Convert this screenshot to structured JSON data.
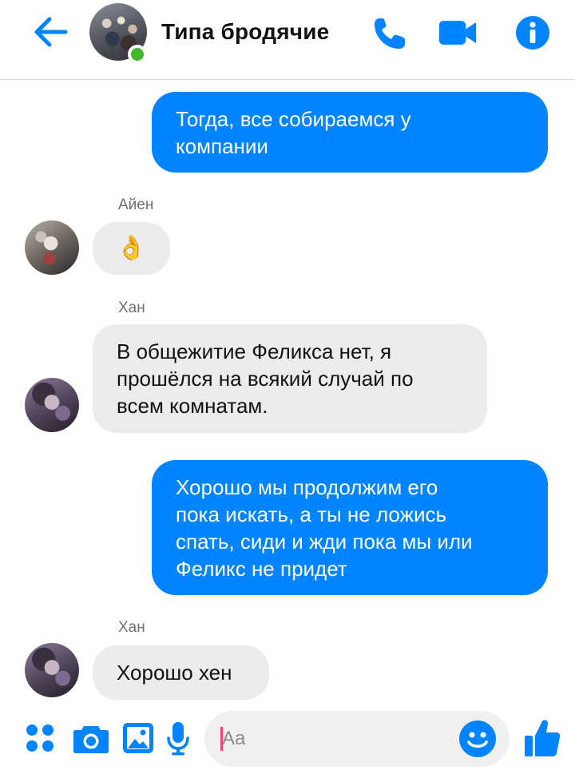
{
  "header": {
    "title": "Типа бродячие",
    "back_icon": "arrow-left-icon",
    "call_icon": "phone-icon",
    "video_icon": "video-camera-icon",
    "info_icon": "info-icon"
  },
  "messages": [
    {
      "direction": "outgoing",
      "lines": [
        "Тогда, все собираемся у",
        "компании"
      ]
    },
    {
      "direction": "incoming",
      "sender": "Айен",
      "text": "👌"
    },
    {
      "direction": "incoming",
      "sender": "Хан",
      "lines": [
        "В общежитие Феликса нет, я",
        "прошёлся на всякий случай по",
        "всем комнатам."
      ]
    },
    {
      "direction": "outgoing",
      "lines": [
        "Хорошо мы продолжим его",
        "пока искать, а ты не ложись",
        "спать, сиди и жди пока мы или",
        "Феликс не придет"
      ]
    },
    {
      "direction": "incoming",
      "sender": "Хан",
      "text": "Хорошо хен"
    }
  ],
  "composer": {
    "placeholder": "Aa",
    "icons": [
      "grid-menu-icon",
      "camera-icon",
      "image-icon",
      "microphone-icon",
      "emoji-icon",
      "thumbs-up-icon"
    ]
  },
  "colors": {
    "accent": "#0084ff",
    "incoming_bubble": "#ececec",
    "online": "#42b72a"
  }
}
